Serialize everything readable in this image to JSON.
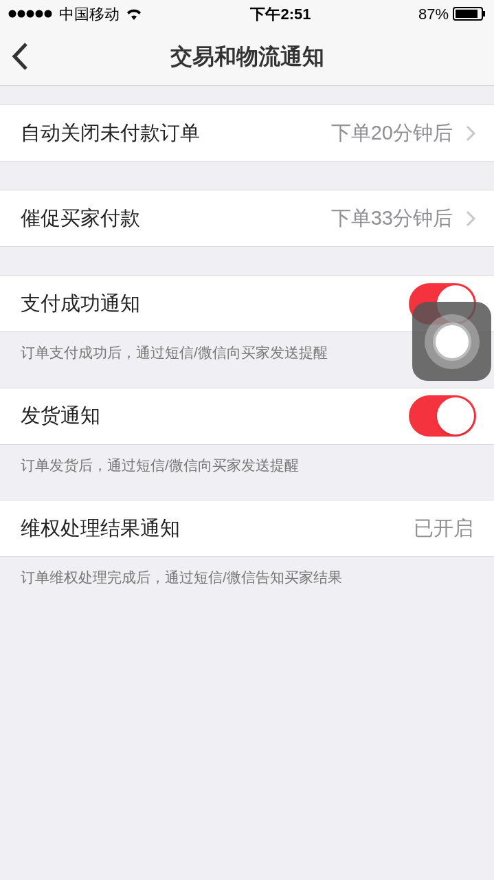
{
  "status_bar": {
    "carrier": "中国移动",
    "time": "下午2:51",
    "battery": "87%"
  },
  "nav": {
    "title": "交易和物流通知"
  },
  "sections": [
    {
      "rows": [
        {
          "kind": "value",
          "label": "自动关闭未付款订单",
          "value": "下单20分钟后"
        }
      ]
    },
    {
      "rows": [
        {
          "kind": "value",
          "label": "催促买家付款",
          "value": "下单33分钟后"
        }
      ]
    },
    {
      "rows": [
        {
          "kind": "toggle",
          "label": "支付成功通知",
          "on": true
        }
      ],
      "note": "订单支付成功后，通过短信/微信向买家发送提醒"
    },
    {
      "rows": [
        {
          "kind": "toggle",
          "label": "发货通知",
          "on": true
        }
      ],
      "note": "订单发货后，通过短信/微信向买家发送提醒"
    },
    {
      "rows": [
        {
          "kind": "status",
          "label": "维权处理结果通知",
          "value": "已开启"
        }
      ],
      "note": "订单维权处理完成后，通过短信/微信告知买家结果"
    }
  ]
}
